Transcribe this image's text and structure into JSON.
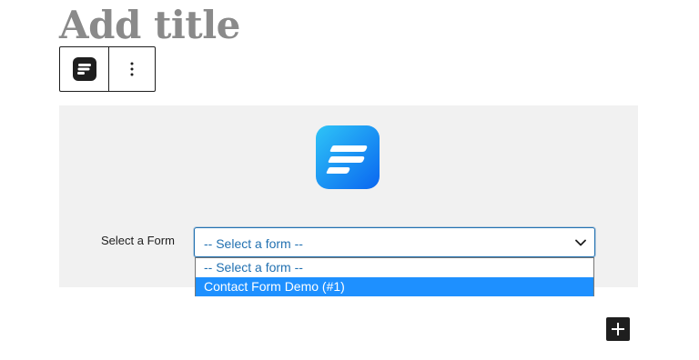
{
  "editor": {
    "title_placeholder": "Add title"
  },
  "toolbar": {
    "block_icon": "fluent-forms-icon",
    "more_options_icon": "vertical-ellipsis-icon"
  },
  "form_block": {
    "logo_icon": "fluent-forms-logo-icon",
    "select_label": "Select a Form",
    "selected_value": "-- Select a form --",
    "options": [
      "-- Select a form --",
      "Contact Form Demo (#1)"
    ],
    "highlighted_option": "Contact Form Demo (#1)"
  },
  "inserter": {
    "icon": "plus-icon"
  },
  "colors": {
    "accent": "#1e90ff",
    "select_text": "#2271b1",
    "logo_gradient_start": "#22b8f5",
    "logo_gradient_end": "#0a6cf0"
  }
}
